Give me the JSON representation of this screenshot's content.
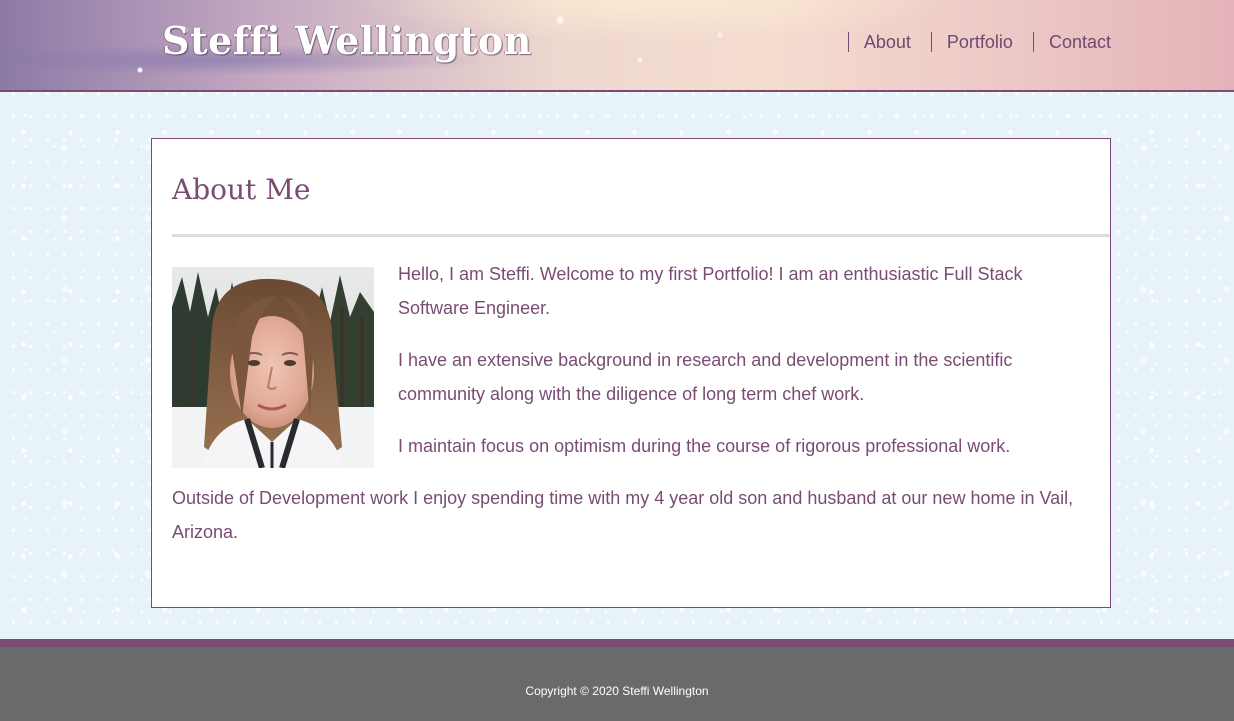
{
  "header": {
    "site_title": "Steffi Wellington",
    "nav": [
      {
        "label": "About"
      },
      {
        "label": "Portfolio"
      },
      {
        "label": "Contact"
      }
    ]
  },
  "about": {
    "heading": "About Me",
    "paragraphs": [
      "Hello, I am Steffi. Welcome to my first Portfolio! I am an enthusiastic Full Stack Software Engineer.",
      "I have an extensive background in research and development in the scientific community along with the diligence of long term chef work.",
      "I maintain focus on optimism during the course of rigorous professional work.",
      "Outside of Development work I enjoy spending time with my 4 year old son and husband at our new home in Vail, Arizona."
    ]
  },
  "footer": {
    "copyright": "Copyright © 2020 Steffi Wellington"
  },
  "colors": {
    "accent": "#7a4c74",
    "footer_bg": "#6a6a6a",
    "page_bg": "#e8f3f8"
  }
}
